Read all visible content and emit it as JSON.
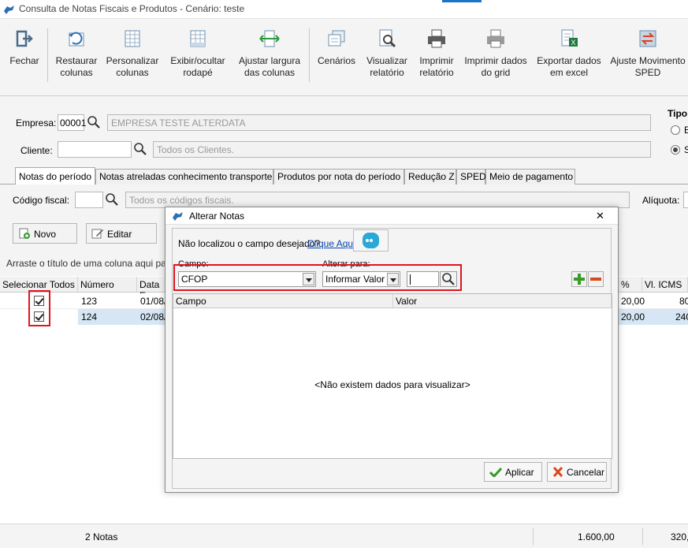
{
  "window": {
    "title": "Consulta de Notas Fiscais e Produtos - Cenário: teste"
  },
  "toolbar": {
    "items": [
      {
        "label": "Fechar",
        "icon": "exit-icon"
      },
      {
        "label": "Restaurar colunas",
        "icon": "restore-columns-icon"
      },
      {
        "label": "Personalizar colunas",
        "icon": "customize-columns-icon"
      },
      {
        "label": "Exibir/ocultar rodapé",
        "icon": "footer-toggle-icon"
      },
      {
        "label": "Ajustar largura das colunas",
        "icon": "column-width-icon"
      },
      {
        "label": "Cenários",
        "icon": "scenarios-icon"
      },
      {
        "label": "Visualizar relatório",
        "icon": "preview-report-icon"
      },
      {
        "label": "Imprimir relatório",
        "icon": "printer-icon"
      },
      {
        "label": "Imprimir dados do grid",
        "icon": "print-grid-icon"
      },
      {
        "label": "Exportar dados em excel",
        "icon": "excel-icon"
      },
      {
        "label": "Ajuste Movimento SPED",
        "icon": "sped-adjust-icon"
      }
    ]
  },
  "filters": {
    "empresa_label": "Empresa:",
    "empresa_code": "00001",
    "empresa_name": "EMPRESA TESTE ALTERDATA",
    "cliente_label": "Cliente:",
    "cliente_code": "",
    "cliente_placeholder": "Todos os Clientes.",
    "tipo_label": "Tipo"
  },
  "tabs": [
    {
      "label": "Notas do período",
      "active": true
    },
    {
      "label": "Notas atreladas conhecimento transporte"
    },
    {
      "label": "Produtos por nota do período"
    },
    {
      "label": "Redução Z"
    },
    {
      "label": "SPED"
    },
    {
      "label": "Meio de pagamento"
    }
  ],
  "panel": {
    "codigo_fiscal_label": "Código fiscal:",
    "codigo_fiscal_placeholder": "Todos os códigos fiscais.",
    "aliquota_label": "Alíquota:",
    "novo_label": "Novo",
    "editar_label": "Editar",
    "group_hint": "Arraste o título de uma coluna aqui pa"
  },
  "grid": {
    "columns": [
      "Selecionar Todos",
      "Número",
      "Data E",
      "% ICM",
      "Vl. ICMS"
    ],
    "rows": [
      {
        "checked": true,
        "numero": "123",
        "data": "01/08/",
        "icm": "20,00",
        "vl_icms": "80"
      },
      {
        "checked": true,
        "numero": "124",
        "data": "02/08/",
        "icm": "20,00",
        "vl_icms": "240"
      }
    ]
  },
  "status": {
    "count": "2 Notas",
    "total1": "1.600,00",
    "total2": "320,"
  },
  "dialog": {
    "title": "Alterar Notas",
    "close": "✕",
    "hint": "Não localizou o campo desejado?",
    "link": "Clique Aqui",
    "campo_label": "Campo:",
    "campo_value": "CFOP",
    "alterar_label": "Alterar para:",
    "alterar_value": "Informar Valor",
    "valor_input": "",
    "col_campo": "Campo",
    "col_valor": "Valor",
    "empty": "<Não existem dados para visualizar>",
    "aplicar": "Aplicar",
    "cancelar": "Cancelar"
  }
}
